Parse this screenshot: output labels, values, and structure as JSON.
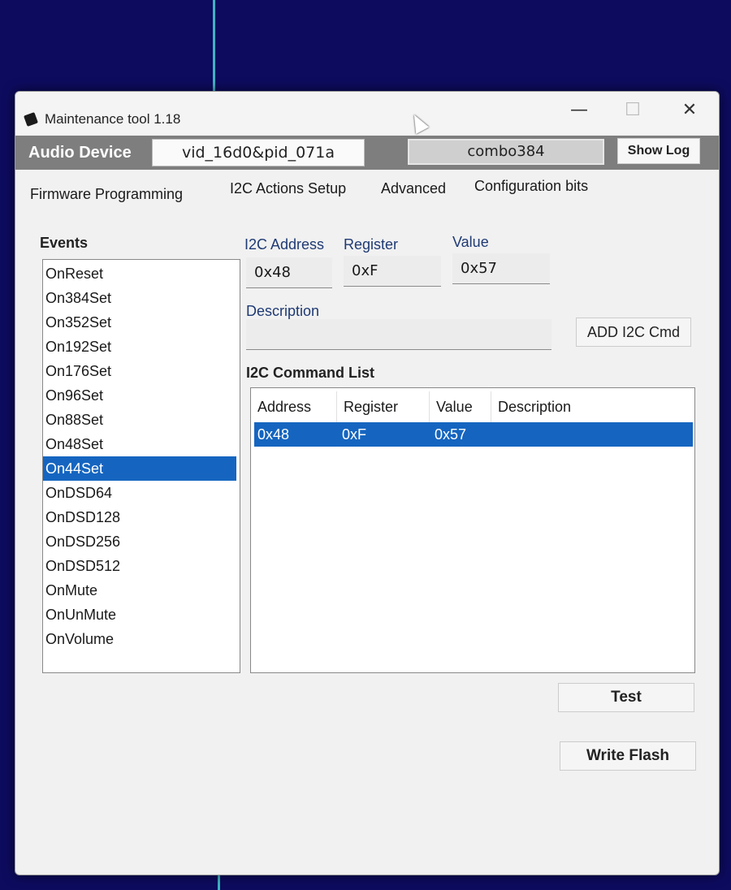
{
  "window": {
    "title": "Maintenance tool 1.18",
    "controls": {
      "minimize": "—",
      "maximize": "☐",
      "close": "✕"
    }
  },
  "device_bar": {
    "label": "Audio Device",
    "device_id": "vid_16d0&pid_071a",
    "combo_value": "combo384",
    "show_log_label": "Show Log"
  },
  "tabs": [
    {
      "label": "Firmware Programming"
    },
    {
      "label": "I2C Actions Setup"
    },
    {
      "label": "Advanced"
    },
    {
      "label": "Configuration bits"
    }
  ],
  "events": {
    "title": "Events",
    "items": [
      "OnReset",
      "On384Set",
      "On352Set",
      "On192Set",
      "On176Set",
      "On96Set",
      "On88Set",
      "On48Set",
      "On44Set",
      "OnDSD64",
      "OnDSD128",
      "OnDSD256",
      "OnDSD512",
      "OnMute",
      "OnUnMute",
      "OnVolume"
    ],
    "selected": "On44Set"
  },
  "form": {
    "i2c_address_label": "I2C Address",
    "i2c_address_value": "0x48",
    "register_label": "Register",
    "register_value": "0xF",
    "value_label": "Value",
    "value_value": "0x57",
    "description_label": "Description",
    "description_value": "",
    "add_button_label": "ADD I2C Cmd"
  },
  "command_list": {
    "title": "I2C Command List",
    "columns": [
      "Address",
      "Register",
      "Value",
      "Description"
    ],
    "rows": [
      {
        "address": "0x48",
        "register": "0xF",
        "value": "0x57",
        "description": ""
      }
    ]
  },
  "actions": {
    "test_label": "Test",
    "write_flash_label": "Write Flash"
  },
  "colors": {
    "selection": "#1565c0",
    "device_bar": "#7e7e7e",
    "desktop": "#0d0b5e"
  }
}
